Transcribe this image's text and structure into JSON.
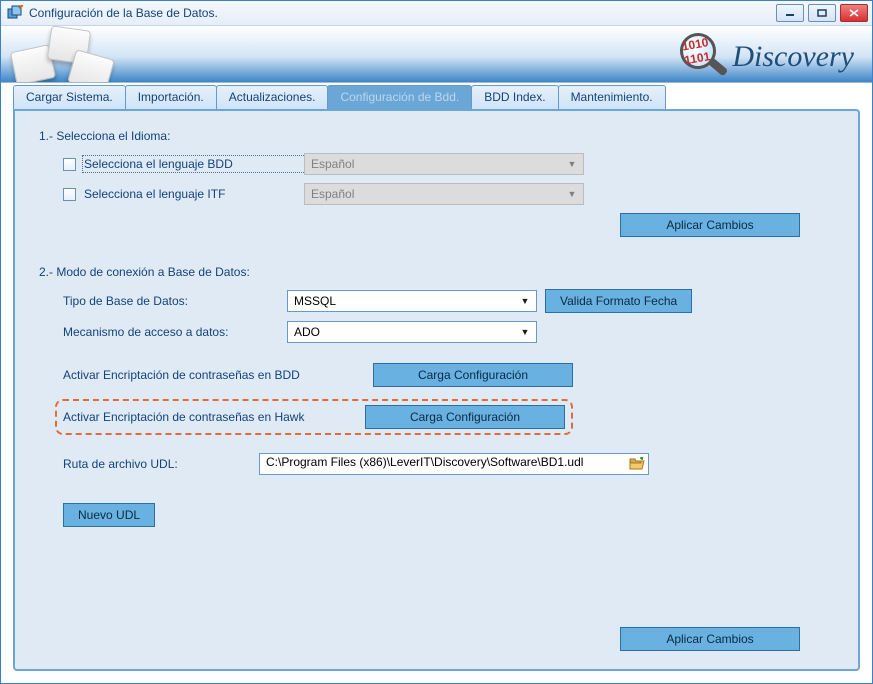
{
  "window": {
    "title": "Configuración de la Base de Datos.",
    "logo_text": "Discovery",
    "mag_digits": "1010\n1101"
  },
  "tabs": [
    {
      "label": "Cargar Sistema."
    },
    {
      "label": "Importación."
    },
    {
      "label": "Actualizaciones."
    },
    {
      "label": "Configuración de Bdd."
    },
    {
      "label": "BDD Index."
    },
    {
      "label": "Mantenimiento."
    }
  ],
  "section1": {
    "title": "1.- Selecciona el Idioma:",
    "bdd_label": "Selecciona el lenguaje BDD",
    "itf_label": "Selecciona el lenguaje ITF",
    "bdd_value": "Español",
    "itf_value": "Español",
    "apply": "Aplicar Cambios"
  },
  "section2": {
    "title": "2.- Modo de conexión a Base de Datos:",
    "db_type_label": "Tipo de Base de Datos:",
    "db_type_value": "MSSQL",
    "validate_btn": "Valida Formato Fecha",
    "access_label": "Mecanismo de acceso a datos:",
    "access_value": "ADO",
    "enc_bdd_label": "Activar Encriptación de contraseñas en BDD",
    "enc_hawk_label": "Activar Encriptación de contraseñas en Hawk",
    "load_config_btn": "Carga Configuración",
    "udl_path_label": "Ruta de archivo UDL:",
    "udl_path_value": "C:\\Program Files (x86)\\LeverIT\\Discovery\\Software\\BD1.udl",
    "new_udl_btn": "Nuevo UDL",
    "apply": "Aplicar Cambios"
  }
}
